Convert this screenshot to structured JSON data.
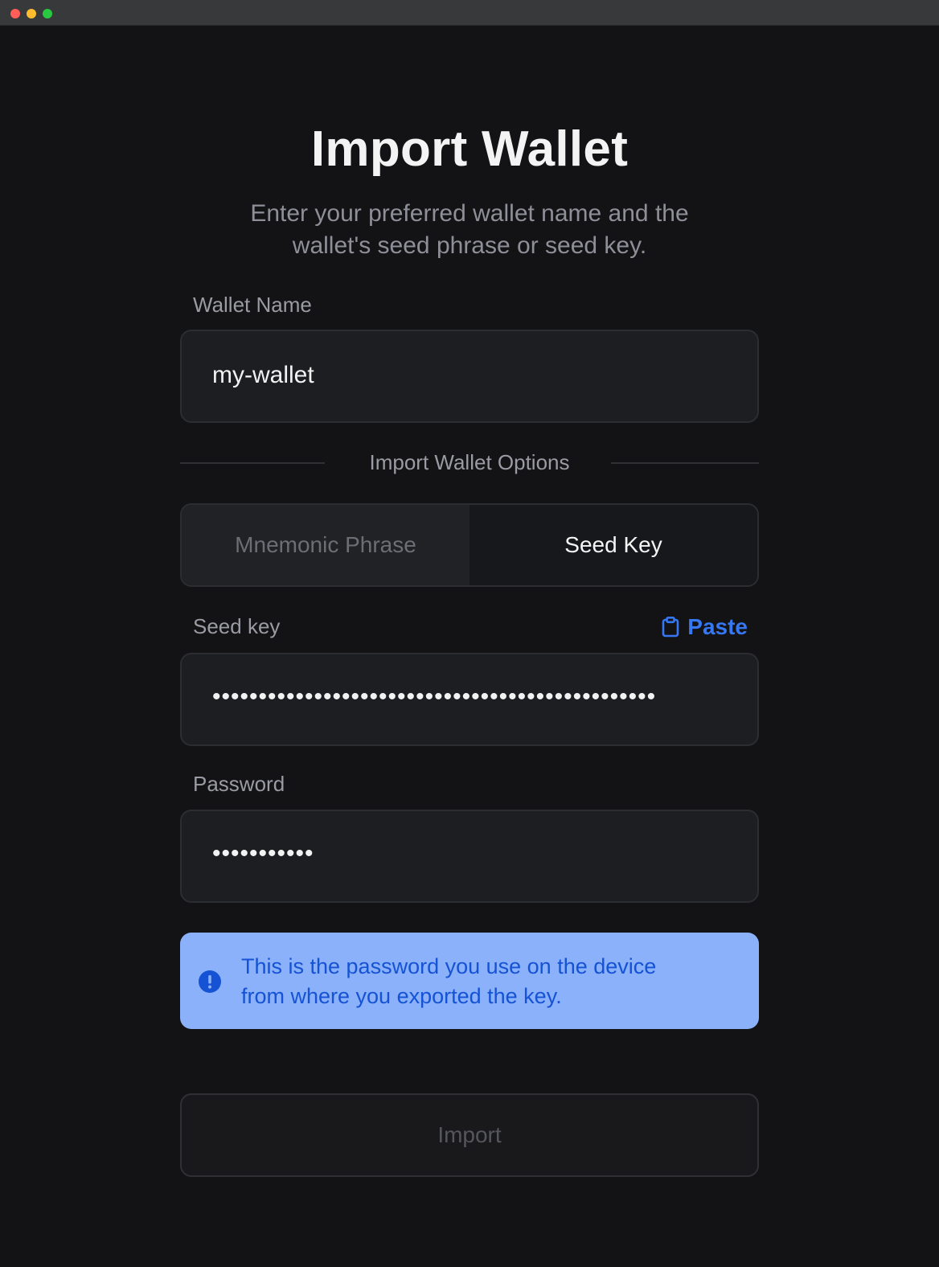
{
  "window": {
    "traffic_lights": {
      "close_color": "#ff5f57",
      "minimize_color": "#febc2e",
      "zoom_color": "#28c840"
    }
  },
  "page": {
    "title": "Import Wallet",
    "subtitle_line1": "Enter your preferred wallet name and the",
    "subtitle_line2": "wallet's seed phrase or seed key."
  },
  "wallet_name": {
    "label": "Wallet Name",
    "value": "my-wallet"
  },
  "options": {
    "divider_label": "Import Wallet Options",
    "tabs": [
      {
        "label": "Mnemonic Phrase",
        "selected": false
      },
      {
        "label": "Seed Key",
        "selected": true
      }
    ]
  },
  "seed_key": {
    "label": "Seed key",
    "paste_label": "Paste",
    "paste_icon": "clipboard-icon",
    "masked_value": "••••••••••••••••••••••••••••••••••••••••••••••••"
  },
  "password": {
    "label": "Password",
    "masked_value": "•••••••••••"
  },
  "info_banner": {
    "icon": "exclamation-circle-icon",
    "text_line1": "This is the password you use on the device",
    "text_line2": "from where you exported the key."
  },
  "import_button": {
    "label": "Import",
    "disabled": true
  },
  "colors": {
    "background": "#131315",
    "accent": "#3677f3",
    "info_background": "#8ab1fa",
    "info_text": "#1552d4"
  }
}
